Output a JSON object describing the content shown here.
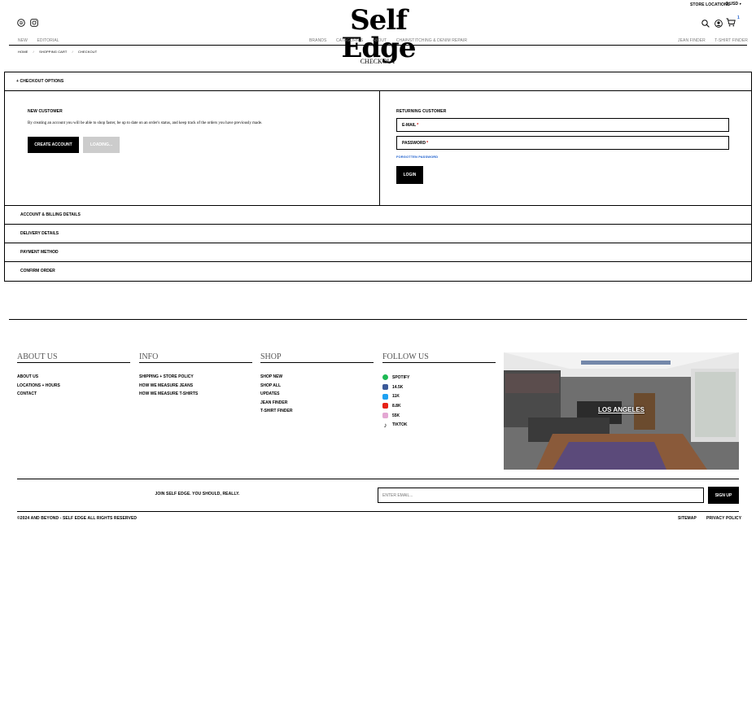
{
  "header": {
    "store_locations": "STORE LOCATIONS",
    "currency": "$ USD",
    "logo": "Self Edge",
    "left_nav": [
      "NEW",
      "EDITORIAL"
    ],
    "center_nav": [
      "BRANDS",
      "CATEGORIES",
      "ABOUT",
      "CHAINSTITCHING & DENIM REPAIR"
    ],
    "right_nav": [
      "JEAN FINDER",
      "T-SHIRT FINDER"
    ],
    "cart_count": "1"
  },
  "breadcrumb": [
    "HOME",
    "SHOPPING CART",
    "CHECKOUT"
  ],
  "page_title": "CHECKOUT",
  "checkout": {
    "options_label": "+ CHECKOUT OPTIONS",
    "new_customer": {
      "title": "NEW CUSTOMER",
      "text": "By creating an account you will be able to shop faster, be up to date on an order's status, and keep track of the orders you have previously made.",
      "create_label": "CREATE ACCOUNT",
      "loading_label": "LOADING..."
    },
    "returning_customer": {
      "title": "RETURNING CUSTOMER",
      "email_label": "E-MAIL",
      "password_label": "PASSWORD",
      "required_mark": "*",
      "forgot_label": "FORGOTTEN PASSWORD",
      "login_label": "LOGIN"
    },
    "steps": [
      "ACCOUNT & BILLING DETAILS",
      "DELIVERY DETAILS",
      "PAYMENT METHOD",
      "CONFIRM ORDER"
    ]
  },
  "footer": {
    "about": {
      "title": "ABOUT US",
      "links": [
        "ABOUT US",
        "LOCATIONS + HOURS",
        "CONTACT"
      ]
    },
    "info": {
      "title": "INFO",
      "links": [
        "SHIPPING + STORE POLICY",
        "HOW WE MEASURE JEANS",
        "HOW WE MEASURE T-SHIRTS"
      ]
    },
    "shop": {
      "title": "SHOP",
      "links": [
        "SHOP NEW",
        "SHOP ALL",
        "UPDATES",
        "JEAN FINDER",
        "T-SHIRT FINDER"
      ]
    },
    "follow": {
      "title": "FOLLOW US",
      "items": [
        {
          "label": "SPOTIFY",
          "icon": "spotify-icon",
          "color": "#1DB954"
        },
        {
          "label": "14.5K",
          "icon": "facebook-icon",
          "color": "#3b5998"
        },
        {
          "label": "11K",
          "icon": "twitter-icon",
          "color": "#1da1f2"
        },
        {
          "label": "8.8K",
          "icon": "youtube-icon",
          "color": "#e62117"
        },
        {
          "label": "55K",
          "icon": "instagram-icon",
          "color": "#e4a7d3"
        },
        {
          "label": "TIKTOK",
          "icon": "tiktok-icon",
          "color": "#000000"
        }
      ]
    },
    "store_label": "LOS ANGELES",
    "newsletter": {
      "text": "JOIN SELF EDGE. YOU SHOULD, REALLY.",
      "placeholder": "ENTER EMAIL...",
      "signup_label": "SIGN UP"
    },
    "copyright": "©2024 AND BEYOND - SELF EDGE ALL RIGHTS RESERVED",
    "bottom_links": [
      "SITEMAP",
      "PRIVACY POLICY"
    ]
  },
  "colors": {
    "link_blue": "#1a5dcc",
    "loading_gray": "#cccccc"
  }
}
